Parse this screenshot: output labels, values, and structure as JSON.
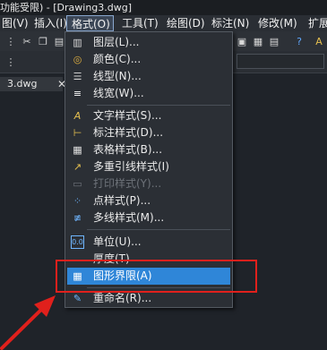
{
  "title": "功能受限) - [Drawing3.dwg]",
  "menubar": [
    {
      "label": "图(V)"
    },
    {
      "label": "插入(I)"
    },
    {
      "label": "格式(O)"
    },
    {
      "label": "工具(T)"
    },
    {
      "label": "绘图(D)"
    },
    {
      "label": "标注(N)"
    },
    {
      "label": "修改(M)"
    },
    {
      "label": "扩展"
    }
  ],
  "document_tab": {
    "label": "3.dwg",
    "close": "✕"
  },
  "format_menu": {
    "items": [
      {
        "label": "图层(L)...",
        "icon": "layers-icon",
        "glyph": "▥",
        "color": "#d8d8d8"
      },
      {
        "label": "颜色(C)...",
        "icon": "color-palette-icon",
        "glyph": "◎",
        "color": "#e0b040"
      },
      {
        "label": "线型(N)...",
        "icon": "linetype-icon",
        "glyph": "☰",
        "color": "#d0d0d0"
      },
      {
        "label": "线宽(W)...",
        "icon": "lineweight-icon",
        "glyph": "≡",
        "color": "#ffffff"
      },
      {
        "label": "文字样式(S)...",
        "icon": "text-style-icon",
        "glyph": "A",
        "color": "#e6c050"
      },
      {
        "label": "标注样式(D)...",
        "icon": "dimension-style-icon",
        "glyph": "⊢",
        "color": "#e6c050"
      },
      {
        "label": "表格样式(B)...",
        "icon": "table-style-icon",
        "glyph": "▦",
        "color": "#e0e0e0"
      },
      {
        "label": "多重引线样式(I)",
        "icon": "multileader-style-icon",
        "glyph": "↗",
        "color": "#e6c050"
      },
      {
        "label": "打印样式(Y)...",
        "icon": "plot-style-icon",
        "glyph": "▭",
        "color": "#6d7279",
        "disabled": true
      },
      {
        "label": "点样式(P)...",
        "icon": "point-style-icon",
        "glyph": "⁘",
        "color": "#6fb6ff"
      },
      {
        "label": "多线样式(M)...",
        "icon": "multiline-style-icon",
        "glyph": "≢",
        "color": "#6fb6ff"
      },
      {
        "label": "单位(U)...",
        "icon": "units-icon",
        "glyph": "0.0",
        "color": "#6fb6ff"
      },
      {
        "label": "厚度(T)",
        "icon": "thickness-icon",
        "glyph": "",
        "color": "#cccccc"
      },
      {
        "label": "图形界限(A)",
        "icon": "drawing-limits-icon",
        "glyph": "▦",
        "color": "#ffffff",
        "selected": true
      },
      {
        "label": "重命名(R)...",
        "icon": "rename-icon",
        "glyph": "✎",
        "color": "#6fb6ff"
      }
    ]
  }
}
